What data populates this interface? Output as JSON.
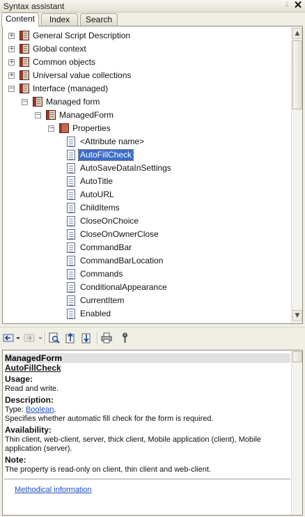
{
  "window": {
    "title": "Syntax assistant",
    "pin_glyph": "ᛸ",
    "close_glyph": "✕"
  },
  "tabs": [
    {
      "label": "Content",
      "active": true
    },
    {
      "label": "Index",
      "active": false
    },
    {
      "label": "Search",
      "active": false
    }
  ],
  "tree": {
    "nodes": [
      {
        "label": "General Script Description",
        "level": 0,
        "expander": "+",
        "icon": "book-icon"
      },
      {
        "label": "Global context",
        "level": 0,
        "expander": "+",
        "icon": "book-icon"
      },
      {
        "label": "Common objects",
        "level": 0,
        "expander": "+",
        "icon": "book-icon"
      },
      {
        "label": "Universal value collections",
        "level": 0,
        "expander": "+",
        "icon": "book-icon"
      },
      {
        "label": "Interface (managed)",
        "level": 0,
        "expander": "−",
        "icon": "book-icon"
      },
      {
        "label": "Managed form",
        "level": 1,
        "expander": "−",
        "icon": "book-icon"
      },
      {
        "label": "ManagedForm",
        "level": 2,
        "expander": "−",
        "icon": "book-icon"
      },
      {
        "label": "Properties",
        "level": 3,
        "expander": "−",
        "icon": "book-closed-icon"
      },
      {
        "label": "<Attribute name>",
        "level": 4,
        "icon": "page-icon"
      },
      {
        "label": "AutoFillCheck",
        "level": 4,
        "icon": "page-icon",
        "selected": true
      },
      {
        "label": "AutoSaveDataInSettings",
        "level": 4,
        "icon": "page-icon"
      },
      {
        "label": "AutoTitle",
        "level": 4,
        "icon": "page-icon"
      },
      {
        "label": "AutoURL",
        "level": 4,
        "icon": "page-icon"
      },
      {
        "label": "ChildItems",
        "level": 4,
        "icon": "page-icon"
      },
      {
        "label": "CloseOnChoice",
        "level": 4,
        "icon": "page-icon"
      },
      {
        "label": "CloseOnOwnerClose",
        "level": 4,
        "icon": "page-icon"
      },
      {
        "label": "CommandBar",
        "level": 4,
        "icon": "page-icon"
      },
      {
        "label": "CommandBarLocation",
        "level": 4,
        "icon": "page-icon"
      },
      {
        "label": "Commands",
        "level": 4,
        "icon": "page-icon"
      },
      {
        "label": "ConditionalAppearance",
        "level": 4,
        "icon": "page-icon"
      },
      {
        "label": "CurrentItem",
        "level": 4,
        "icon": "page-icon"
      },
      {
        "label": "Enabled",
        "level": 4,
        "icon": "page-icon"
      }
    ],
    "scroll_up": "▲",
    "scroll_down": "▼"
  },
  "toolbar": {
    "buttons": [
      {
        "name": "back-button",
        "icon": "back-arrow-icon",
        "has_dropdown": true
      },
      {
        "name": "forward-button",
        "icon": "forward-arrow-icon",
        "has_dropdown": true
      },
      {
        "name": "find-in-tree-button",
        "icon": "find-in-tree-icon"
      },
      {
        "name": "go-up-button",
        "icon": "go-up-icon"
      },
      {
        "name": "sync-content-button",
        "icon": "sync-icon"
      },
      {
        "name": "print-button",
        "icon": "print-icon"
      },
      {
        "name": "settings-button",
        "icon": "wrench-icon"
      }
    ]
  },
  "description": {
    "header": "ManagedForm",
    "item_name": "AutoFillCheck",
    "usage_label": "Usage:",
    "usage_text": "Read and write.",
    "description_label": "Description:",
    "type_prefix": "Type: ",
    "type_link": "Boolean",
    "type_suffix": ".",
    "description_text": "Specifies whether automatic fill check for the form is required.",
    "availability_label": "Availability:",
    "availability_line1": "Thin client, web-client, server, thick client, Mobile application (client), Mobile",
    "availability_line2": "application (server).",
    "note_label": "Note:",
    "note_text": "The property is read-only on client, thin client and web-client.",
    "methodical_link": "Methodical information"
  },
  "colors": {
    "selection": "#3b6cc9",
    "link": "#1f4fbf",
    "book": "#9b3b2a"
  }
}
